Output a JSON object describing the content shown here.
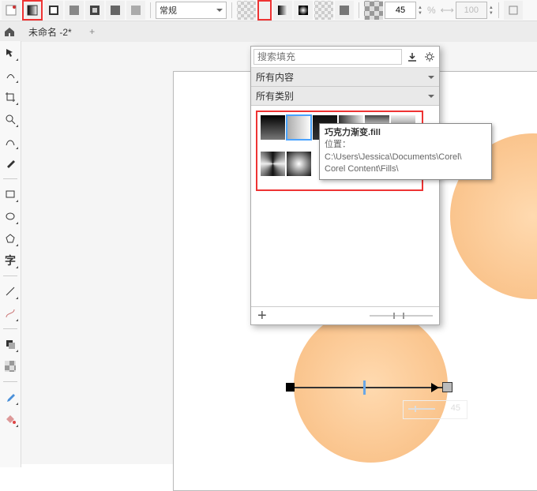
{
  "top": {
    "style_dropdown": "常规",
    "angle_value": "45",
    "opacity_value": "100",
    "percent": "%"
  },
  "tabs": {
    "doc_name": "未命名 -2*",
    "new_tab": "+"
  },
  "fill_popup": {
    "search_placeholder": "搜索填充",
    "row_all_content": "所有内容",
    "row_all_category": "所有类别",
    "plus": "+"
  },
  "tooltip": {
    "title": "巧克力渐变.fill",
    "label": "位置：",
    "path1": "C:\\Users\\Jessica\\Documents\\Corel\\",
    "path2": "Corel Content\\Fills\\"
  },
  "disabled_slider": {
    "value": "45"
  }
}
